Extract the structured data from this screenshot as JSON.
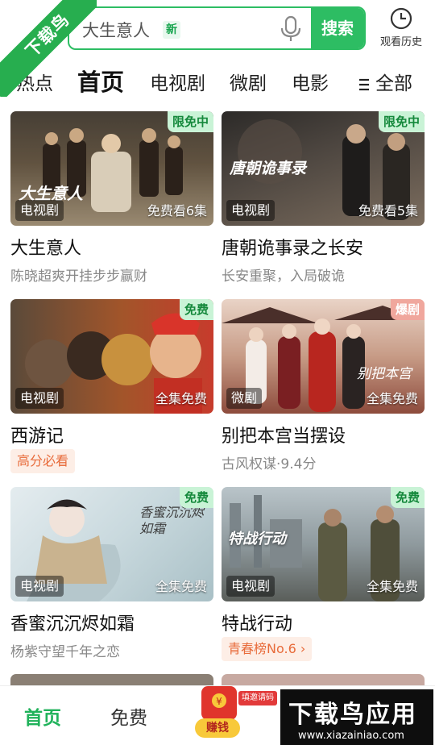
{
  "watermark": {
    "ribbon_text": "下载鸟",
    "brand_main": "下载鸟应用",
    "brand_url": "www.xiazainiao.com"
  },
  "search": {
    "placeholder": "大生意人",
    "new_badge": "新",
    "button_label": "搜索"
  },
  "history": {
    "label": "观看历史"
  },
  "tabs": [
    {
      "label": "热点"
    },
    {
      "label": "首页"
    },
    {
      "label": "电视剧"
    },
    {
      "label": "微剧"
    },
    {
      "label": "电影"
    }
  ],
  "tab_all": {
    "label": "全部"
  },
  "cards": [
    {
      "title": "大生意人",
      "subtitle": "陈晓超爽开挂步步赢财",
      "badge": "限免中",
      "badge_style": "green",
      "type": "电视剧",
      "episodes": "免费看6集",
      "thumb_overlay": "大生意人"
    },
    {
      "title": "唐朝诡事录之长安",
      "subtitle": "长安重聚，入局破诡",
      "badge": "限免中",
      "badge_style": "green",
      "type": "电视剧",
      "episodes": "免费看5集",
      "thumb_overlay": "唐朝诡事录"
    },
    {
      "title": "西游记",
      "chip": "高分必看",
      "badge": "免费",
      "badge_style": "green",
      "type": "电视剧",
      "episodes": "全集免费"
    },
    {
      "title": "别把本宫当摆设",
      "subtitle": "古风权谋·9.4分",
      "badge": "爆剧",
      "badge_style": "red",
      "type": "微剧",
      "episodes": "全集免费",
      "thumb_overlay": "别把本宫"
    },
    {
      "title": "香蜜沉沉烬如霜",
      "subtitle": "杨紫守望千年之恋",
      "badge": "免费",
      "badge_style": "green",
      "type": "电视剧",
      "episodes": "全集免费",
      "thumb_overlay": "香蜜沉沉烬如霜"
    },
    {
      "title": "特战行动",
      "chip": "青春榜No.6 ›",
      "badge": "免费",
      "badge_style": "green",
      "type": "电视剧",
      "episodes": "全集免费",
      "thumb_overlay": "特战行动"
    }
  ],
  "bottom_nav": {
    "home": "首页",
    "free": "免费",
    "earn": "赚钱",
    "invite": "填邀请码"
  },
  "colors": {
    "accent": "#2dbd63",
    "badge_green_bg": "#c9f3d6",
    "badge_red_bg": "#f0a79d",
    "chip_orange": "#e86b3a"
  }
}
